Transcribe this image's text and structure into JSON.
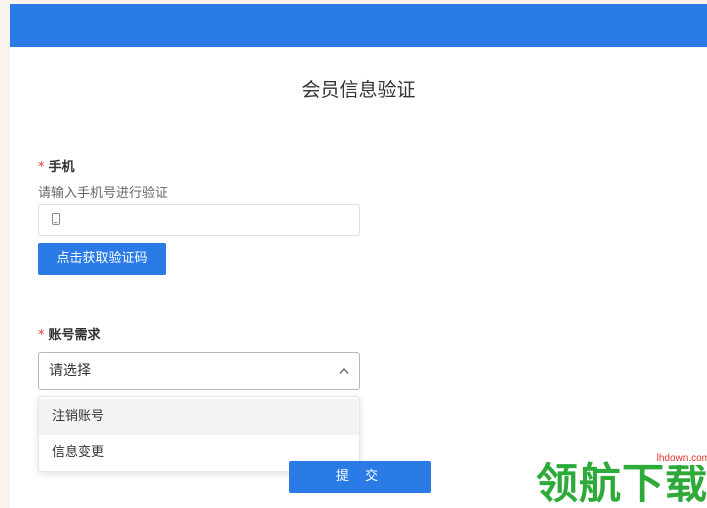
{
  "header": {
    "bar_color": "#2b7be6"
  },
  "form": {
    "title": "会员信息验证",
    "phone": {
      "required_mark": "*",
      "label": "手机",
      "hint": "请输入手机号进行验证",
      "value": "",
      "icon": "mobile-phone-icon",
      "code_button_label": "点击获取验证码"
    },
    "account": {
      "required_mark": "*",
      "label": "账号需求",
      "selected": "请选择",
      "icon": "chevron-up-icon",
      "options": [
        "注销账号",
        "信息变更"
      ]
    },
    "submit_label": "提 交"
  },
  "watermark": {
    "text": "领航下载",
    "site": "lhdown.com"
  }
}
